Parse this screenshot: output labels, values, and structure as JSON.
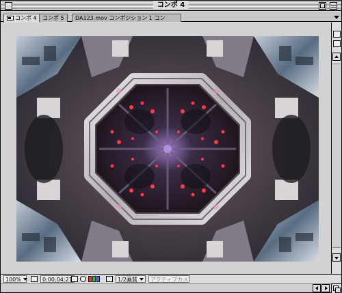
{
  "window": {
    "title": "コンポ 4"
  },
  "tabs": [
    {
      "label": "コンポ 4",
      "active": true,
      "has_icon": true
    },
    {
      "label": "コンポ 5",
      "active": false
    },
    {
      "label": "DA123.mov コンポジション 1 コン",
      "active": false
    }
  ],
  "viewer": {
    "image_description_icon": "kaleidoscope-footage"
  },
  "status_bar": {
    "zoom": "100%",
    "timecode": "0;00;04;21",
    "resolution": "1/2画質",
    "camera": "アクティブカメ..."
  },
  "icons": {
    "close": "close-box-icon",
    "zoom": "zoom-box-icon",
    "collapse": "collapse-box-icon",
    "tab_menu": "chevron-down-icon",
    "grow": "grow-box-icon"
  },
  "colors": {
    "chrome": "#dddddd",
    "viewer_bg": "#d2d2d2",
    "rgb_red": "#e23a3a",
    "rgb_green": "#3fb34a",
    "rgb_blue": "#4a6ee0"
  }
}
